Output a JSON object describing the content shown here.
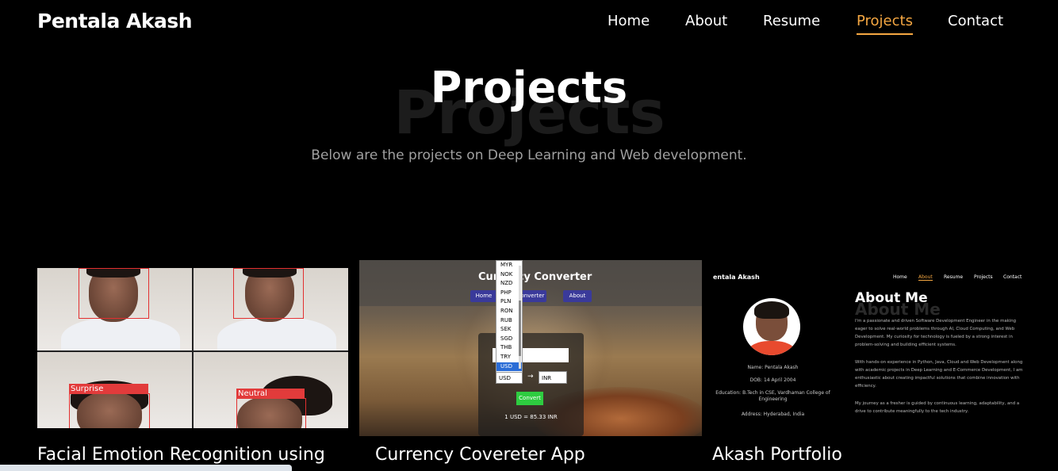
{
  "header": {
    "brand": "Pentala Akash",
    "nav": [
      {
        "label": "Home"
      },
      {
        "label": "About"
      },
      {
        "label": "Resume"
      },
      {
        "label": "Projects",
        "active": true
      },
      {
        "label": "Contact"
      }
    ],
    "accent_color": "#f5a742"
  },
  "hero": {
    "background_word": "Projects",
    "title": "Projects",
    "subtitle": "Below are the projects on Deep Learning and Web development."
  },
  "projects": [
    {
      "title": "Facial Emotion Recognition using",
      "thumbnail": {
        "labels": [
          "Surprise",
          "Neutral"
        ]
      }
    },
    {
      "title": "Currency Covereter App",
      "thumbnail": {
        "app_title": "Currency Converter",
        "buttons": [
          "Home",
          "Converter",
          "About"
        ],
        "dropdown_options": [
          "MYR",
          "NOK",
          "NZD",
          "PHP",
          "PLN",
          "RON",
          "RUB",
          "SEK",
          "SGD",
          "THB",
          "TRY",
          "USD"
        ],
        "selected_currency": "USD",
        "from_currency": "USD",
        "to_currency": "INR",
        "convert_label": "Convert",
        "rate_text": "1 USD = 85.33 INR"
      }
    },
    {
      "title": "Akash Portfolio",
      "thumbnail": {
        "brand": "entala Akash",
        "nav": [
          "Home",
          "About",
          "Resume",
          "Projects",
          "Contact"
        ],
        "about_heading": "About Me",
        "info": [
          "Name: Pentala Akash",
          "DOB: 14 April 2004",
          "Education: B.Tech in CSE, Vardhaman College of Engineering",
          "Address: Hyderabad, India"
        ],
        "paragraphs": [
          "I'm a passionate and driven Software Development Engineer in the making eager to solve real-world problems through AI, Cloud Computing, and Web Development. My curiosity for technology is fueled by a strong interest in problem-solving and building efficient systems.",
          "With hands-on experience in Python, Java, Cloud and Web Development along with academic projects in Deep Learning and E-Commerce Development, I am enthusiastic about creating impactful solutions that combine innovation with efficiency.",
          "My journey as a fresher is guided by continuous learning, adaptability, and a drive to contribute meaningfully to the tech industry."
        ]
      }
    }
  ]
}
